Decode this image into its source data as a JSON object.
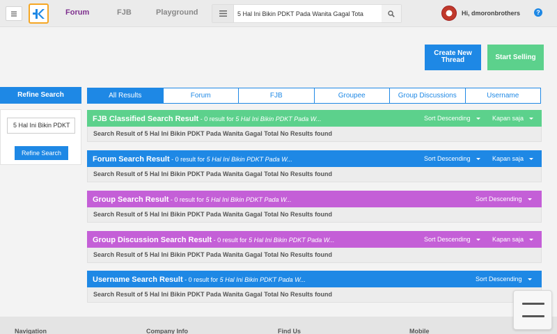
{
  "header": {
    "nav": [
      "Forum",
      "FJB",
      "Playground"
    ],
    "search_value": "5 Hal Ini Bikin PDKT Pada Wanita Gagal Tota",
    "greeting": "Hi, dmoronbrothers",
    "help": "?"
  },
  "actions": {
    "create_thread": "Create New Thread",
    "start_selling": "Start Selling"
  },
  "sidebar": {
    "title": "Refine Search",
    "input_value": "5 Hal Ini Bikin PDKT",
    "button": "Refine Search"
  },
  "tabs": [
    "All Results",
    "Forum",
    "FJB",
    "Groupee",
    "Group Discussions",
    "Username"
  ],
  "results": [
    {
      "title": "FJB Classified Search Result",
      "count": " - 0 result for ",
      "query": "5 Hal Ini Bikin PDKT Pada W...",
      "sort": "Sort Descending",
      "time": "Kapan saja",
      "body": "Search Result of 5 Hal Ini Bikin PDKT Pada Wanita Gagal Total No Results found",
      "color": "#5cd18c"
    },
    {
      "title": "Forum Search Result",
      "count": " - 0 result for ",
      "query": "5 Hal Ini Bikin PDKT Pada W...",
      "sort": "Sort Descending",
      "time": "Kapan saja",
      "body": "Search Result of 5 Hal Ini Bikin PDKT Pada Wanita Gagal Total No Results found",
      "color": "#1e88e5"
    },
    {
      "title": "Group Search Result",
      "count": " - 0 result for ",
      "query": "5 Hal Ini Bikin PDKT Pada W...",
      "sort": "Sort Descending",
      "body": "Search Result of 5 Hal Ini Bikin PDKT Pada Wanita Gagal Total No Results found",
      "color": "#c45fd7"
    },
    {
      "title": "Group Discussion Search Result",
      "count": " - 0 result for ",
      "query": "5 Hal Ini Bikin PDKT Pada W...",
      "sort": "Sort Descending",
      "time": "Kapan saja",
      "body": "Search Result of 5 Hal Ini Bikin PDKT Pada Wanita Gagal Total No Results found",
      "color": "#c45fd7"
    },
    {
      "title": "Username Search Result",
      "count": " - 0 result for ",
      "query": "5 Hal Ini Bikin PDKT Pada W...",
      "sort": "Sort Descending",
      "body": "Search Result of 5 Hal Ini Bikin PDKT Pada Wanita Gagal Total No Results found",
      "color": "#1e88e5"
    }
  ],
  "footer": [
    "Navigation",
    "Company Info",
    "Find Us",
    "Mobile"
  ],
  "icons": {
    "menu": "hamburger-icon",
    "logo": "kaskus-logo",
    "search": "search-icon",
    "help": "help-icon",
    "float_menu": "menu-icon"
  }
}
